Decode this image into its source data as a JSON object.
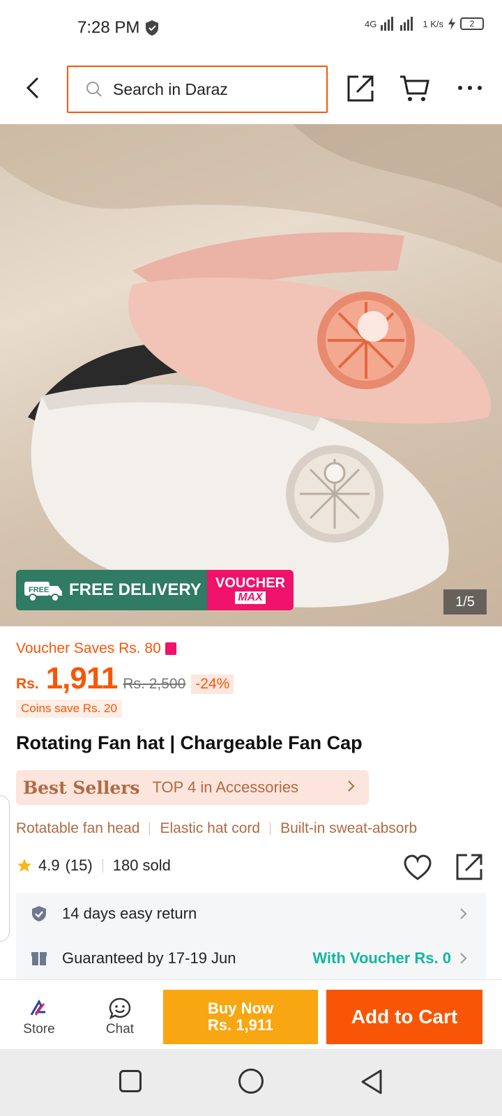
{
  "status_bar": {
    "time": "7:28 PM",
    "network": "4G",
    "speed": "1 K/s",
    "battery": "2"
  },
  "header": {
    "search_placeholder": "Search in Daraz"
  },
  "gallery": {
    "promo_free_delivery": "FREE DELIVERY",
    "promo_truck_tag": "FREE",
    "promo_voucher_line1": "VOUCHER",
    "promo_voucher_line2": "MAX",
    "image_counter": "1/5"
  },
  "pricing": {
    "voucher_saves": "Voucher Saves Rs. 80",
    "currency": "Rs.",
    "price": "1,911",
    "original_price": "Rs. 2,500",
    "discount": "-24%",
    "coins_save": "Coins save Rs. 20"
  },
  "product": {
    "title": "Rotating Fan hat | Chargeable Fan Cap",
    "best_sellers_title": "Best Sellers",
    "best_sellers_rank": "TOP 4 in Accessories",
    "features": [
      "Rotatable fan head",
      "Elastic hat cord",
      "Built-in sweat-absorb"
    ],
    "rating": "4.9",
    "reviews": "(15)",
    "sold": "180 sold"
  },
  "services": {
    "return_text": "14 days easy return",
    "delivery_text": "Guaranteed by 17-19 Jun",
    "delivery_voucher": "With Voucher Rs. 0"
  },
  "bottom_bar": {
    "store_label": "Store",
    "chat_label": "Chat",
    "buy_now_line1": "Buy Now",
    "buy_now_line2": "Rs. 1,911",
    "add_to_cart": "Add to Cart"
  },
  "colors": {
    "brand_orange": "#f85606",
    "buy_now_yellow": "#f8a611",
    "promo_green": "#2f7b63",
    "promo_pink": "#f0126b",
    "voucher_green": "#12b89c"
  }
}
